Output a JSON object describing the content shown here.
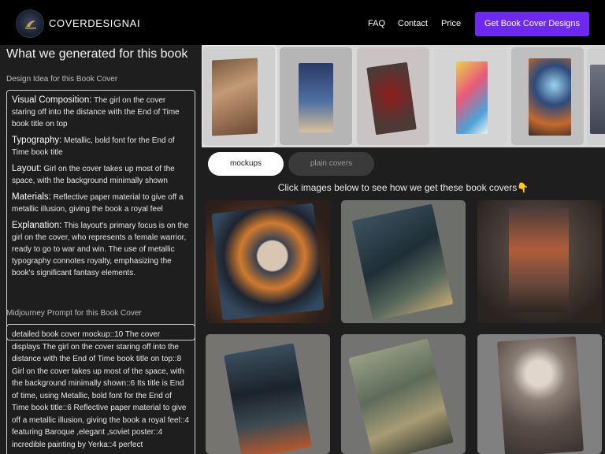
{
  "header": {
    "brand": "COVERDESIGNAI",
    "nav": [
      "FAQ",
      "Contact",
      "Price"
    ],
    "cta": "Get Book Cover Designs"
  },
  "left": {
    "title": "What we generated for this book",
    "design_label": "Design Idea for this Book Cover",
    "design": [
      {
        "key": "Visual Composition:",
        "text": "The girl on the cover staring off into the distance with the End of Time book title on top"
      },
      {
        "key": "Typography:",
        "text": "Metallic, bold font for the End of Time book title"
      },
      {
        "key": "Layout:",
        "text": "Girl on the cover takes up most of the space, with the background minimally shown"
      },
      {
        "key": "Materials:",
        "text": "Reflective paper material to give off a metallic illusion, giving the book a royal feel"
      },
      {
        "key": "Explanation:",
        "text": "This layout's primary focus is on the girl on the cover, who represents a female warrior, ready to go to war and win. The use of metallic typography connotes royalty, emphasizing the book's significant fantasy elements."
      }
    ],
    "prompt_label": "Midjourney Prompt for this Book Cover",
    "prompt": "detailed book cover mockup::10 The cover displays The girl on the cover staring off into the distance with the End of Time book title on top::8 Girl on the cover takes up most of the space, with the background minimally shown::6 Its title is End of time, using Metallic, bold font for the End of Time book title::6 Reflective paper material to give off a metallic illusion, giving the book a royal feel::4 featuring Baroque ,elegant ,soviet poster::4 incredible painting by Yerka::4 perfect"
  },
  "tabs": {
    "mockups": "mockups",
    "plain": "plain covers"
  },
  "hint": {
    "text": "Click images below to see how we get these book covers",
    "emoji": "👇"
  },
  "colors": {
    "accent": "#6d28f2",
    "topbar": "#000000",
    "panel": "#1e1e1e"
  },
  "strip_thumbs": [
    "girl-silver-crown-cover",
    "boy-under-stars-cover",
    "red-rose-cover",
    "rainbow-splash-cover",
    "sunset-planet-cover",
    "partial-cover"
  ],
  "gallery": [
    "girl-clock-portal-cover",
    "dark-castle-cover",
    "red-haired-woman-cover",
    "dark-warrior-woman-cover",
    "horse-rider-cover",
    "girl-silver-crown-mockup"
  ]
}
